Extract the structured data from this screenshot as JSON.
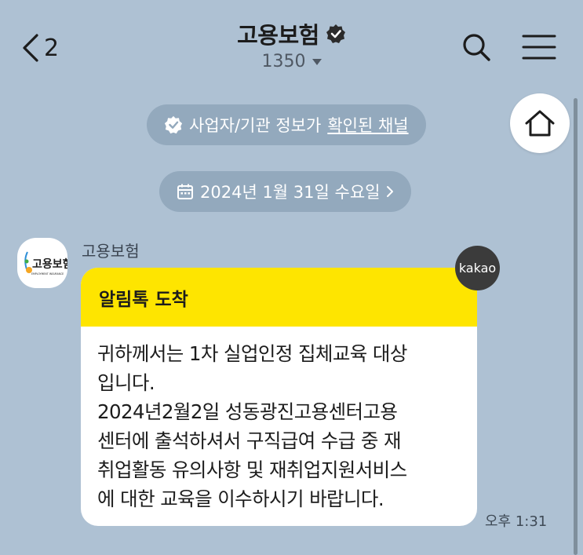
{
  "header": {
    "back_count": "2",
    "title": "고용보험",
    "subtitle": "1350"
  },
  "notices": {
    "verify_text": "사업자/기관 정보가",
    "verify_link": "확인된 채널",
    "date_text": "2024년 1월 31일 수요일"
  },
  "message": {
    "sender": "고용보험",
    "avatar_logo_text": "고용보험",
    "avatar_logo_subtext": "EMPLOYMENT INSURANCE",
    "badge": "kakao",
    "header_title": "알림톡 도착",
    "body": "귀하께서는 1차 실업인정 집체교육 대상\n입니다.\n2024년2월2일 성동광진고용센터고용\n센터에 출석하셔서 구직급여 수급 중 재\n취업활동 유의사항 및 재취업지원서비스\n에 대한 교육을 이수하시기 바랍니다.",
    "time": "오후 1:31"
  },
  "colors": {
    "background": "#aec1d3",
    "pill": "#93a9bd",
    "header_yellow": "#fee500",
    "badge_dark": "#3b3b3b"
  },
  "icons": [
    "back-chevron-icon",
    "verified-badge-icon",
    "dropdown-caret-icon",
    "search-icon",
    "hamburger-menu-icon",
    "home-icon",
    "check-badge-icon",
    "calendar-icon",
    "chevron-right-icon"
  ]
}
